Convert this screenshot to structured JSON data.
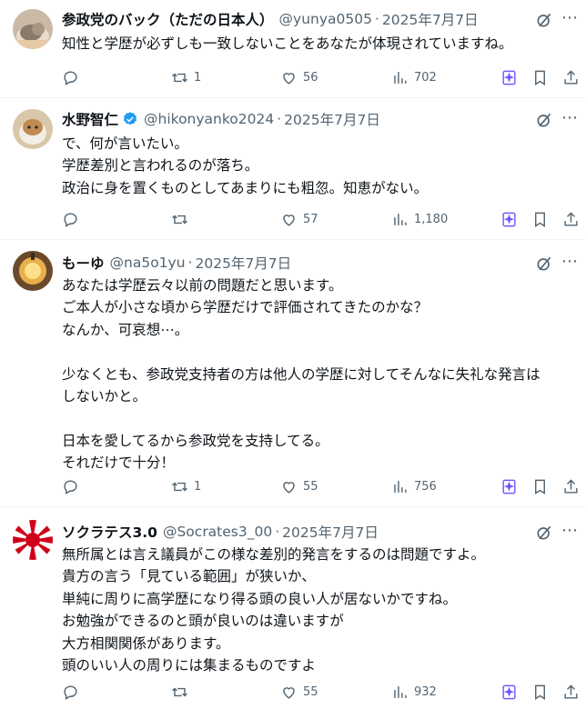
{
  "tweets": [
    {
      "name": "参政党のバック（ただの日本人）",
      "handle": "@yunya0505",
      "date": "2025年7月7日",
      "verified": false,
      "text": "知性と学歴が必ずしも一致しないことをあなたが体現されていますね。",
      "retweets": "1",
      "likes": "56",
      "views": "702",
      "avatar_icon": "cat-avatar"
    },
    {
      "name": "水野智仁",
      "handle": "@hikonyanko2024",
      "date": "2025年7月7日",
      "verified": true,
      "text": "で、何が言いたい。\n学歴差別と言われるのが落ち。\n政治に身を置くものとしてあまりにも粗忽。知恵がない。",
      "retweets": "",
      "likes": "57",
      "views": "1,180",
      "avatar_icon": "hamster-avatar"
    },
    {
      "name": "もーゆ",
      "handle": "@na5o1yu",
      "date": "2025年7月7日",
      "verified": false,
      "text": "あなたは学歴云々以前の問題だと思います。\nご本人が小さな頃から学歴だけで評価されてきたのかな？\nなんか、可哀想⋯。\n\n少なくとも、参政党支持者の方は他人の学歴に対してそんなに失礼な発言は\nしないかと。\n\n日本を愛してるから参政党を支持してる。\nそれだけで十分！",
      "retweets": "1",
      "likes": "55",
      "views": "756",
      "avatar_icon": "lantern-avatar"
    },
    {
      "name": "ソクラテス3.0",
      "handle": "@Socrates3_00",
      "date": "2025年7月7日",
      "verified": false,
      "text": "無所属とは言え議員がこの様な差別的発言をするのは問題ですよ。\n貴方の言う「見ている範囲」が狭いか、\n単純に周りに高学歴になり得る頭の良い人が居ないかですね。\nお勉強ができるのと頭が良いのは違いますが\n大方相関関係があります。\n頭のいい人の周りには集まるものですよ",
      "retweets": "",
      "likes": "55",
      "views": "932",
      "avatar_icon": "rising-sun-avatar"
    }
  ],
  "colors": {
    "text": "#0f1419",
    "secondary": "#536471",
    "verified": "#1d9bf0",
    "grok": "#7856ff",
    "divider": "#eff3f4"
  }
}
